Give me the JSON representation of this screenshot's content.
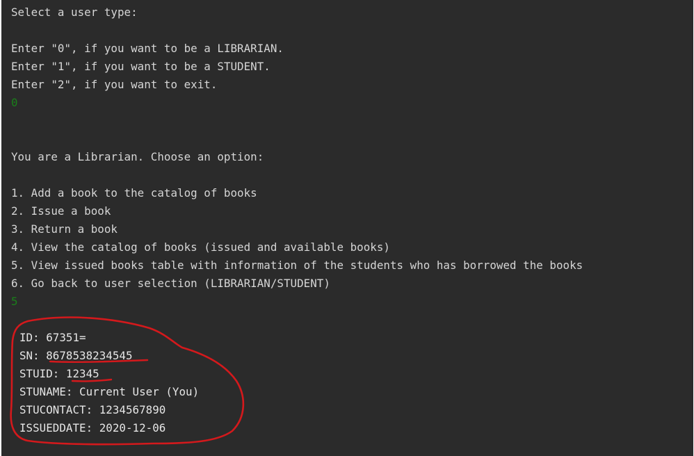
{
  "console": {
    "select_prompt": "Select a user type:",
    "user_options": [
      "Enter \"0\", if you want to be a LIBRARIAN.",
      "Enter \"1\", if you want to be a STUDENT.",
      "Enter \"2\", if you want to exit."
    ],
    "user_choice": "0",
    "librarian_prompt": "You are a Librarian. Choose an option:",
    "librarian_options": [
      "1. Add a book to the catalog of books",
      "2. Issue a book",
      "3. Return a book",
      "4. View the catalog of books (issued and available books)",
      "5. View issued books table with information of the students who has borrowed the books",
      "6. Go back to user selection (LIBRARIAN/STUDENT)"
    ],
    "librarian_choice": "5",
    "record": [
      "ID: 67351=",
      "SN: 8678538234545",
      "STUID: 12345",
      "STUNAME: Current User (You)",
      "STUCONTACT: 1234567890",
      "ISSUEDDATE: 2020-12-06"
    ]
  },
  "colors": {
    "console_background": "#2b2b2b",
    "console_text": "#d6d6d6",
    "user_input": "#1a7f1a",
    "annotation": "#d4191c"
  }
}
